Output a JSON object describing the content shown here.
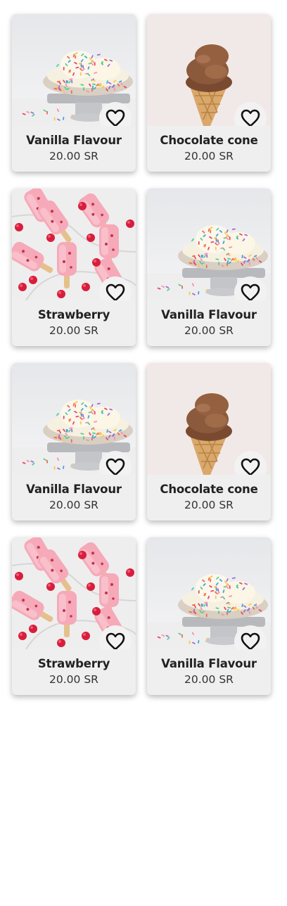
{
  "products": [
    {
      "name": "Vanilla Flavour",
      "price": "20.00 SR",
      "image": "vanilla-bowl",
      "favorited": false
    },
    {
      "name": "Chocolate cone",
      "price": "20.00 SR",
      "image": "chocolate-cone",
      "favorited": false
    },
    {
      "name": "Strawberry",
      "price": "20.00 SR",
      "image": "strawberry-popsicles",
      "favorited": false
    },
    {
      "name": "Vanilla Flavour",
      "price": "20.00 SR",
      "image": "vanilla-bowl",
      "favorited": false
    },
    {
      "name": "Vanilla Flavour",
      "price": "20.00 SR",
      "image": "vanilla-bowl",
      "favorited": false
    },
    {
      "name": "Chocolate cone",
      "price": "20.00 SR",
      "image": "chocolate-cone",
      "favorited": false
    },
    {
      "name": "Strawberry",
      "price": "20.00 SR",
      "image": "strawberry-popsicles",
      "favorited": false
    },
    {
      "name": "Vanilla Flavour",
      "price": "20.00 SR",
      "image": "vanilla-bowl",
      "favorited": false
    }
  ],
  "icons": {
    "favorite": "heart-outline-icon"
  }
}
